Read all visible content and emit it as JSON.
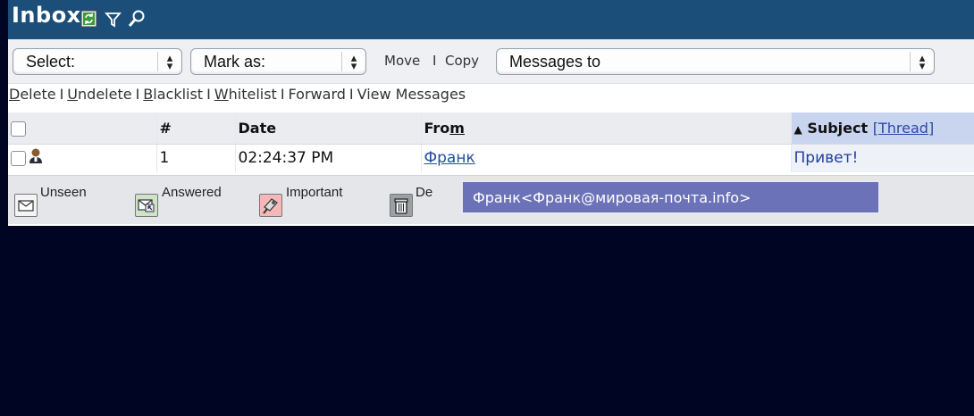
{
  "header": {
    "title": "Inbox"
  },
  "toolbar": {
    "select_label": "Select:",
    "mark_as_label": "Mark as:",
    "move_label": "Move",
    "separator": "I",
    "copy_label": "Copy",
    "destination_value": "Messages to"
  },
  "actions": {
    "delete": {
      "first": "D",
      "rest": "elete"
    },
    "undelete": {
      "first": "U",
      "rest": "ndelete"
    },
    "blacklist": {
      "first": "B",
      "rest": "lacklist"
    },
    "whitelist": {
      "first": "W",
      "rest": "hitelist"
    },
    "forward": "Forward",
    "view_messages": "View Messages",
    "separator": "I"
  },
  "table": {
    "headers": {
      "number": "#",
      "date": "Date",
      "from_a": "Fro",
      "from_b": "m",
      "subject_arrow": "▲",
      "subject": "Subject",
      "thread_open": "[",
      "thread": "Thread",
      "thread_close": "]"
    },
    "rows": [
      {
        "number": "1",
        "date": "02:24:37 PM",
        "from": "Франк",
        "subject": "Привет!"
      }
    ]
  },
  "legend": {
    "unseen": "Unseen",
    "answered": "Answered",
    "important": "Important",
    "deleted_partial": "De"
  },
  "tooltip": {
    "text": "Франк<Франк@мировая-почта.info>"
  },
  "colors": {
    "header_bg": "#1c4e7a",
    "tooltip_bg": "#6b72b8",
    "page_bg": "#000524",
    "link": "#1f4f9f"
  }
}
